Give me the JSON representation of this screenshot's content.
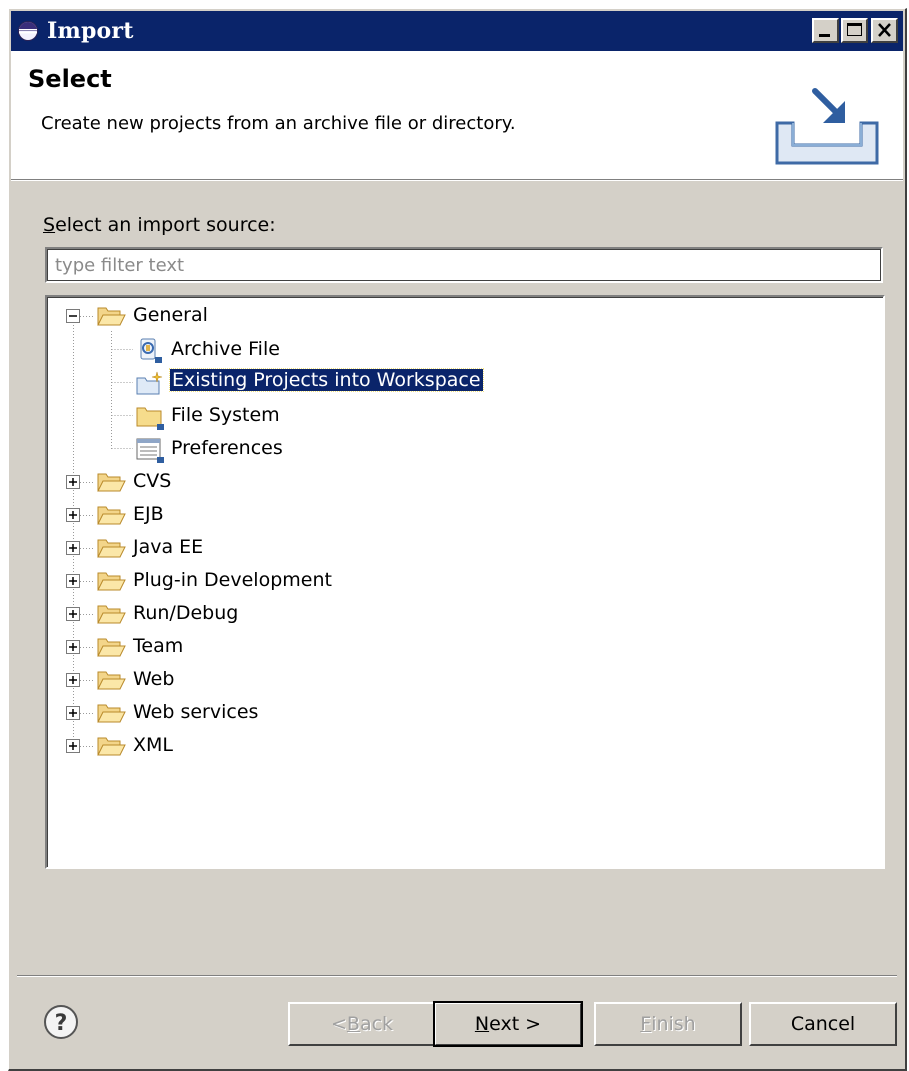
{
  "window": {
    "title": "Import",
    "icon": "eclipse-icon",
    "controls": [
      "minimize-icon",
      "maximize-icon",
      "close-icon"
    ]
  },
  "header": {
    "title": "Select",
    "description": "Create new projects from an archive file or directory.",
    "banner_icon": "import-wizard-icon"
  },
  "source": {
    "label_mnemonic": "S",
    "label_rest": "elect an import source:",
    "filter_placeholder": "type filter text"
  },
  "tree": {
    "general": {
      "label": "General",
      "expanded": true,
      "children": [
        {
          "label": "Archive File",
          "icon": "archive-file-icon"
        },
        {
          "label": "Existing Projects into Workspace",
          "icon": "existing-projects-icon",
          "selected": true
        },
        {
          "label": "File System",
          "icon": "folder-icon"
        },
        {
          "label": "Preferences",
          "icon": "preferences-icon"
        }
      ]
    },
    "categories": [
      {
        "label": "CVS"
      },
      {
        "label": "EJB"
      },
      {
        "label": "Java EE"
      },
      {
        "label": "Plug-in Development"
      },
      {
        "label": "Run/Debug"
      },
      {
        "label": "Team"
      },
      {
        "label": "Web"
      },
      {
        "label": "Web services"
      },
      {
        "label": "XML"
      }
    ]
  },
  "buttons": {
    "back_pre": "< ",
    "back_mnemonic": "B",
    "back_rest": "ack",
    "next_mnemonic": "N",
    "next_rest": "ext >",
    "finish_mnemonic": "F",
    "finish_rest": "inish",
    "cancel": "Cancel"
  },
  "colors": {
    "titlebar": "#0a246a",
    "dialog_bg": "#d4d0c8",
    "selection": "#0a246a"
  }
}
